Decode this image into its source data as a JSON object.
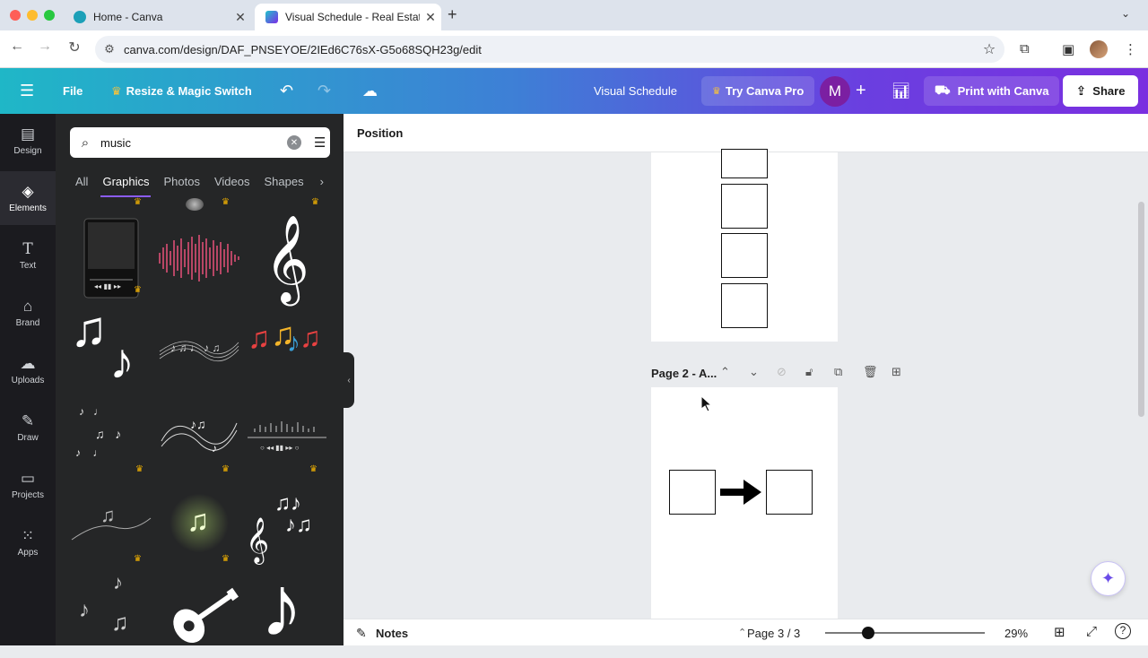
{
  "browser": {
    "tabs": [
      {
        "title": "Home - Canva",
        "icon": "canva-logo-icon"
      },
      {
        "title": "Visual Schedule - Real Estate",
        "icon": "canva-doc-icon"
      }
    ],
    "url": "canva.com/design/DAF_PNSEYOE/2IEd6C76sX-G5o68SQH23g/edit"
  },
  "header": {
    "file_label": "File",
    "resize_label": "Resize & Magic Switch",
    "doc_title": "Visual Schedule",
    "try_pro_label": "Try Canva Pro",
    "avatar_initial": "M",
    "print_label": "Print with Canva",
    "share_label": "Share"
  },
  "rail": {
    "items": [
      {
        "label": "Design",
        "icon": "design-icon"
      },
      {
        "label": "Elements",
        "icon": "elements-icon"
      },
      {
        "label": "Text",
        "icon": "text-icon"
      },
      {
        "label": "Brand",
        "icon": "brand-icon"
      },
      {
        "label": "Uploads",
        "icon": "uploads-icon"
      },
      {
        "label": "Draw",
        "icon": "draw-icon"
      },
      {
        "label": "Projects",
        "icon": "projects-icon"
      },
      {
        "label": "Apps",
        "icon": "apps-icon"
      }
    ],
    "active": "Elements"
  },
  "panel": {
    "search_value": "music",
    "categories": [
      "All",
      "Graphics",
      "Photos",
      "Videos",
      "Shapes"
    ],
    "active_category": "Graphics",
    "graphics": [
      "music-player-graphic",
      "sound-wave-graphic",
      "treble-clef-graphic",
      "music-notes-graphic",
      "music-staff-graphic",
      "colorful-notes-graphic",
      "scattered-notes-graphic",
      "swirl-notes-graphic",
      "audio-player-graphic",
      "line-notes-graphic",
      "glowing-note-graphic",
      "clef-notes-graphic",
      "doodle-notes-graphic",
      "guitar-graphic",
      "eighth-note-graphic"
    ]
  },
  "toolbar": {
    "position_label": "Position"
  },
  "canvas": {
    "page2_label": "Page 2 - A..."
  },
  "bottom": {
    "notes_label": "Notes",
    "page_indicator": "Page 3 / 3",
    "zoom_label": "29%"
  },
  "colors": {
    "header_start": "#1fb7c7",
    "header_end": "#7a2fe0",
    "panel_bg": "#252627",
    "rail_bg": "#1b1b1f",
    "accent": "#8b5cf6",
    "avatar": "#7b1fa2"
  }
}
